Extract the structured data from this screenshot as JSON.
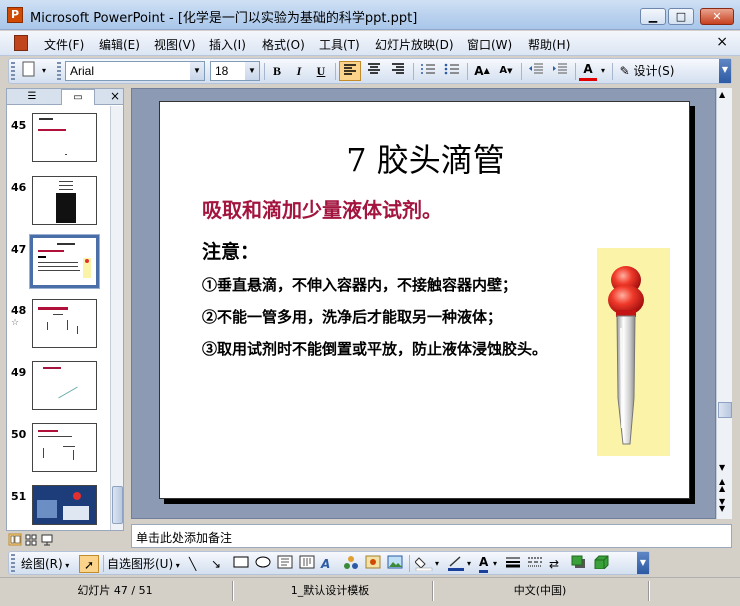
{
  "window": {
    "title": "Microsoft PowerPoint - [化学是一门以实验为基础的科学ppt.ppt]",
    "app_icon_letter": "P",
    "controls": {
      "minimize": "▁",
      "maximize": "□",
      "close": "✕"
    }
  },
  "menu": {
    "items": [
      "文件(F)",
      "编辑(E)",
      "视图(V)",
      "插入(I)",
      "格式(O)",
      "工具(T)",
      "幻灯片放映(D)",
      "窗口(W)",
      "帮助(H)"
    ],
    "close_doc": "×"
  },
  "toolbar": {
    "font_name": "Arial",
    "font_size": "18",
    "bold": "B",
    "italic": "I",
    "underline": "U",
    "design_label": "设计(S)"
  },
  "slides_panel": {
    "close": "×",
    "slides": [
      {
        "num": "45"
      },
      {
        "num": "46"
      },
      {
        "num": "47"
      },
      {
        "num": "48"
      },
      {
        "num": "49"
      },
      {
        "num": "50"
      },
      {
        "num": "51"
      }
    ]
  },
  "slide": {
    "title": "7  胶头滴管",
    "subtitle": "吸取和滴加少量液体试剂。",
    "note_heading": "注意：",
    "lines": [
      "①垂直悬滴，不伸入容器内，不接触容器内壁；",
      "②不能一管多用，洗净后才能取另一种液体；",
      "③取用试剂时不能倒置或平放，防止液体浸蚀胶头。"
    ]
  },
  "notes": {
    "placeholder": "单击此处添加备注"
  },
  "draw_toolbar": {
    "draw_label": "绘图(R)",
    "autoshape_label": "自选图形(U)"
  },
  "status": {
    "slide_info": "幻灯片 47 / 51",
    "template": "1_默认设计模板",
    "language": "中文(中国)"
  },
  "colors": {
    "accent_red": "#a3153f",
    "workspace_bg": "#8c9ab4",
    "selection_border": "#4a6ea8"
  }
}
